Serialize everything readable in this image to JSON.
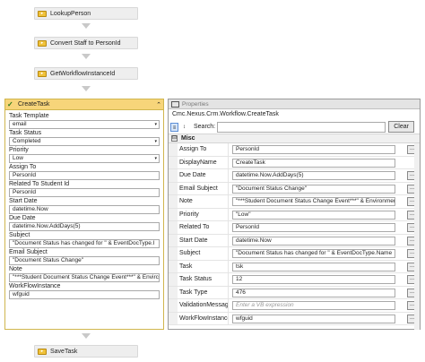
{
  "flow": {
    "top_activities": [
      "LookupPerson",
      "Convert Staff to PersonId",
      "GetWorkflowInstanceId"
    ],
    "bottom_activity": "SaveTask"
  },
  "create_task": {
    "title": "CreateTask",
    "fields": [
      {
        "label": "Task Template",
        "value": "email",
        "type": "select"
      },
      {
        "label": "Task Status",
        "value": "Completed",
        "type": "select"
      },
      {
        "label": "Priority",
        "value": "Low",
        "type": "select"
      },
      {
        "label": "Assign To",
        "value": "PersonId",
        "type": "text"
      },
      {
        "label": "Related To Student Id",
        "value": "PersonId",
        "type": "text"
      },
      {
        "label": "Start Date",
        "value": "datetime.Now",
        "type": "text"
      },
      {
        "label": "Due Date",
        "value": "datetime.Now.AddDays(5)",
        "type": "text"
      },
      {
        "label": "Subject",
        "value": "\"Document Status has changed for \" & EventDocType.I",
        "type": "text"
      },
      {
        "label": "Email Subject",
        "value": "\"Document Status Change\"",
        "type": "text"
      },
      {
        "label": "Note",
        "value": "\"***Student Document Status Change Event***\" & Envirc",
        "type": "text"
      },
      {
        "label": "WorkFlowInstance",
        "value": "wfguid",
        "type": "text"
      }
    ]
  },
  "properties": {
    "window_title": "Properties",
    "type_name": "Cmc.Nexus.Crm.Workflow.CreateTask",
    "search_label": "Search:",
    "search_value": "",
    "clear_label": "Clear",
    "category_toggle": "⊟",
    "category": "Misc",
    "rows": [
      {
        "name": "Assign To",
        "value": "PersonId",
        "ellipsis": true,
        "placeholder": false
      },
      {
        "name": "DisplayName",
        "value": "CreateTask",
        "ellipsis": false,
        "placeholder": false
      },
      {
        "name": "Due Date",
        "value": "datetime.Now.AddDays(5)",
        "ellipsis": true,
        "placeholder": false
      },
      {
        "name": "Email Subject",
        "value": "\"Document Status Change\"",
        "ellipsis": true,
        "placeholder": false
      },
      {
        "name": "Note",
        "value": "\"***Student Document Status Change Event***\" & Environment",
        "ellipsis": true,
        "placeholder": false
      },
      {
        "name": "Priority",
        "value": "\"Low\"",
        "ellipsis": true,
        "placeholder": false
      },
      {
        "name": "Related To",
        "value": "PersonId",
        "ellipsis": true,
        "placeholder": false
      },
      {
        "name": "Start Date",
        "value": "datetime.Now",
        "ellipsis": true,
        "placeholder": false
      },
      {
        "name": "Subject",
        "value": "\"Document Status has changed for \" & EventDocType.Name",
        "ellipsis": true,
        "placeholder": false
      },
      {
        "name": "Task",
        "value": "tsk",
        "ellipsis": true,
        "placeholder": false
      },
      {
        "name": "Task Status",
        "value": "12",
        "ellipsis": true,
        "placeholder": false
      },
      {
        "name": "Task Type",
        "value": "476",
        "ellipsis": true,
        "placeholder": false
      },
      {
        "name": "ValidationMessages",
        "value": "Enter a VB expression",
        "ellipsis": true,
        "placeholder": true
      },
      {
        "name": "WorkFlowInstance",
        "value": "wfguid",
        "ellipsis": true,
        "placeholder": false
      }
    ]
  },
  "icons": {
    "activity": "activity-icon",
    "check": "checkmark-icon",
    "collapse": "collapse-chevron-icon",
    "sort_categorized": "categorized-sort-icon",
    "sort_alpha": "alphabetical-sort-icon",
    "ellipsis": "ellipsis-icon",
    "dropdown": "dropdown-arrow-icon"
  },
  "colors": {
    "activity_header": "#f7d57a",
    "activity_border": "#d0b64e",
    "activity_bg": "#eeeeee",
    "selection_accent": "#5c8ed6"
  }
}
